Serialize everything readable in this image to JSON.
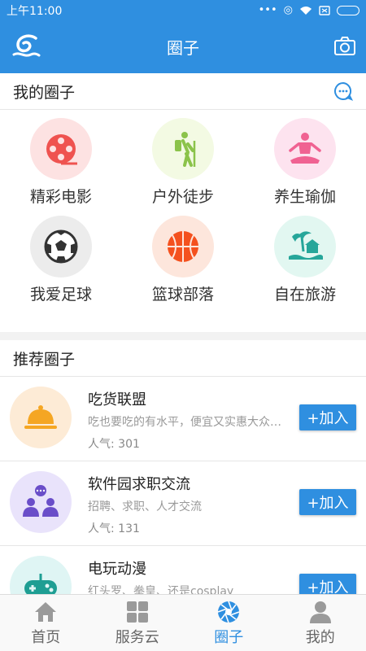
{
  "status": {
    "time": "上午11:00"
  },
  "header": {
    "title": "圈子"
  },
  "my_circles": {
    "title": "我的圈子",
    "items": [
      {
        "label": "精彩电影",
        "icon": "film-reel-icon",
        "bg": "#fde2e2",
        "color": "#ef5350"
      },
      {
        "label": "户外徒步",
        "icon": "hiker-icon",
        "bg": "#f3fae3",
        "color": "#8bc34a"
      },
      {
        "label": "养生瑜伽",
        "icon": "yoga-icon",
        "bg": "#fde3ef",
        "color": "#f06292"
      },
      {
        "label": "我爱足球",
        "icon": "soccer-ball-icon",
        "bg": "#ececec",
        "color": "#333333"
      },
      {
        "label": "篮球部落",
        "icon": "basketball-icon",
        "bg": "#fde6dc",
        "color": "#f4511e"
      },
      {
        "label": "自在旅游",
        "icon": "palm-island-icon",
        "bg": "#e2f7f1",
        "color": "#26a69a"
      }
    ]
  },
  "recommend": {
    "title": "推荐圈子",
    "join_label": "+加入",
    "items": [
      {
        "name": "吃货联盟",
        "desc": "吃也要吃的有水平，便宜又实惠大众美食",
        "pop": "人气: 301",
        "icon": "food-cloche-icon",
        "bg": "#fdebd6"
      },
      {
        "name": "软件园求职交流",
        "desc": "招聘、求职、人才交流",
        "pop": "人气: 131",
        "icon": "people-chat-icon",
        "bg": "#e9e3fb"
      },
      {
        "name": "电玩动漫",
        "desc": "红头罗、拳皇、还是cosplay",
        "pop": "",
        "icon": "game-controller-icon",
        "bg": "#dff5f4"
      }
    ]
  },
  "tabs": [
    {
      "label": "首页",
      "icon": "home-icon",
      "active": false
    },
    {
      "label": "服务云",
      "icon": "grid-icon",
      "active": false
    },
    {
      "label": "圈子",
      "icon": "aperture-icon",
      "active": true
    },
    {
      "label": "我的",
      "icon": "user-icon",
      "active": false
    }
  ],
  "colors": {
    "primary": "#2f8fe0"
  }
}
